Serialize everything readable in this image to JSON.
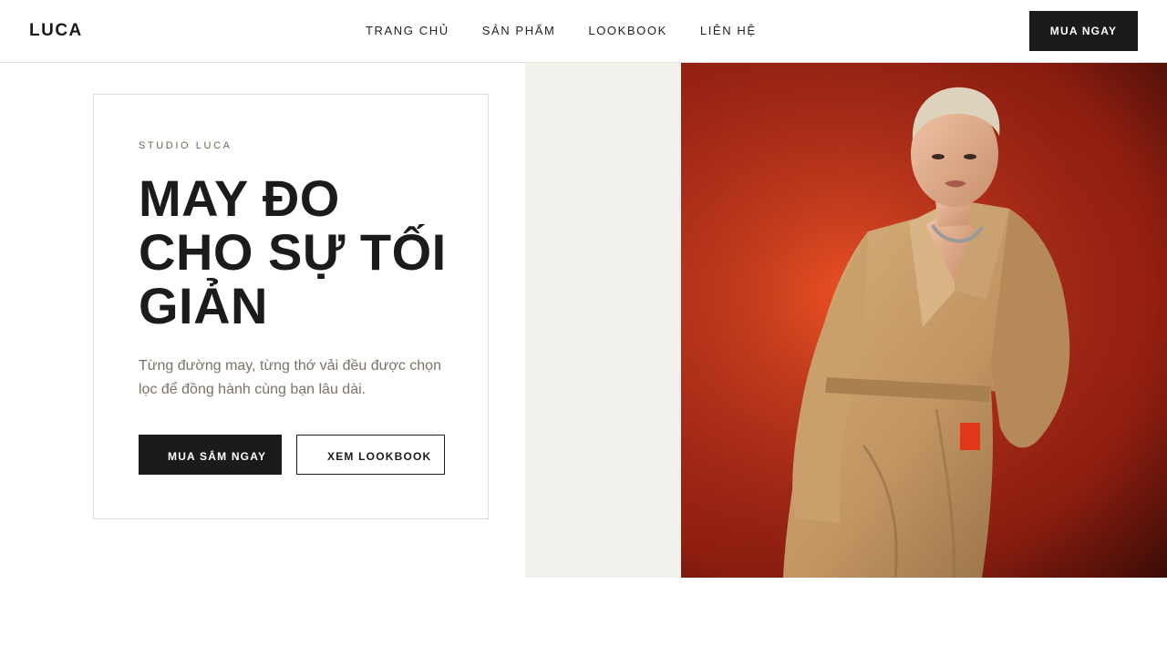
{
  "header": {
    "logo": "LUCA",
    "nav": [
      "TRANG CHỦ",
      "SẢN PHẨM",
      "LOOKBOOK",
      "LIÊN HỆ"
    ],
    "cta": "MUA NGAY"
  },
  "hero": {
    "eyebrow": "STUDIO LUCA",
    "headline": [
      "MAY ĐO",
      "CHO SỰ TỐI",
      "GIẢN"
    ],
    "description": "Từng đường may, từng thớ vải đều được chọn lọc để đồng hành cùng bạn lâu dài.",
    "primary_button": "MUA SẮM NGAY",
    "secondary_button": "XEM LOOKBOOK"
  },
  "colors": {
    "ink": "#1b1b1b",
    "beige": "#f3f1ec",
    "photo_bg": "#c3311b",
    "coat": "#c49a66"
  },
  "icons": {
    "hero_image": "model-in-trench-coat-photo"
  }
}
